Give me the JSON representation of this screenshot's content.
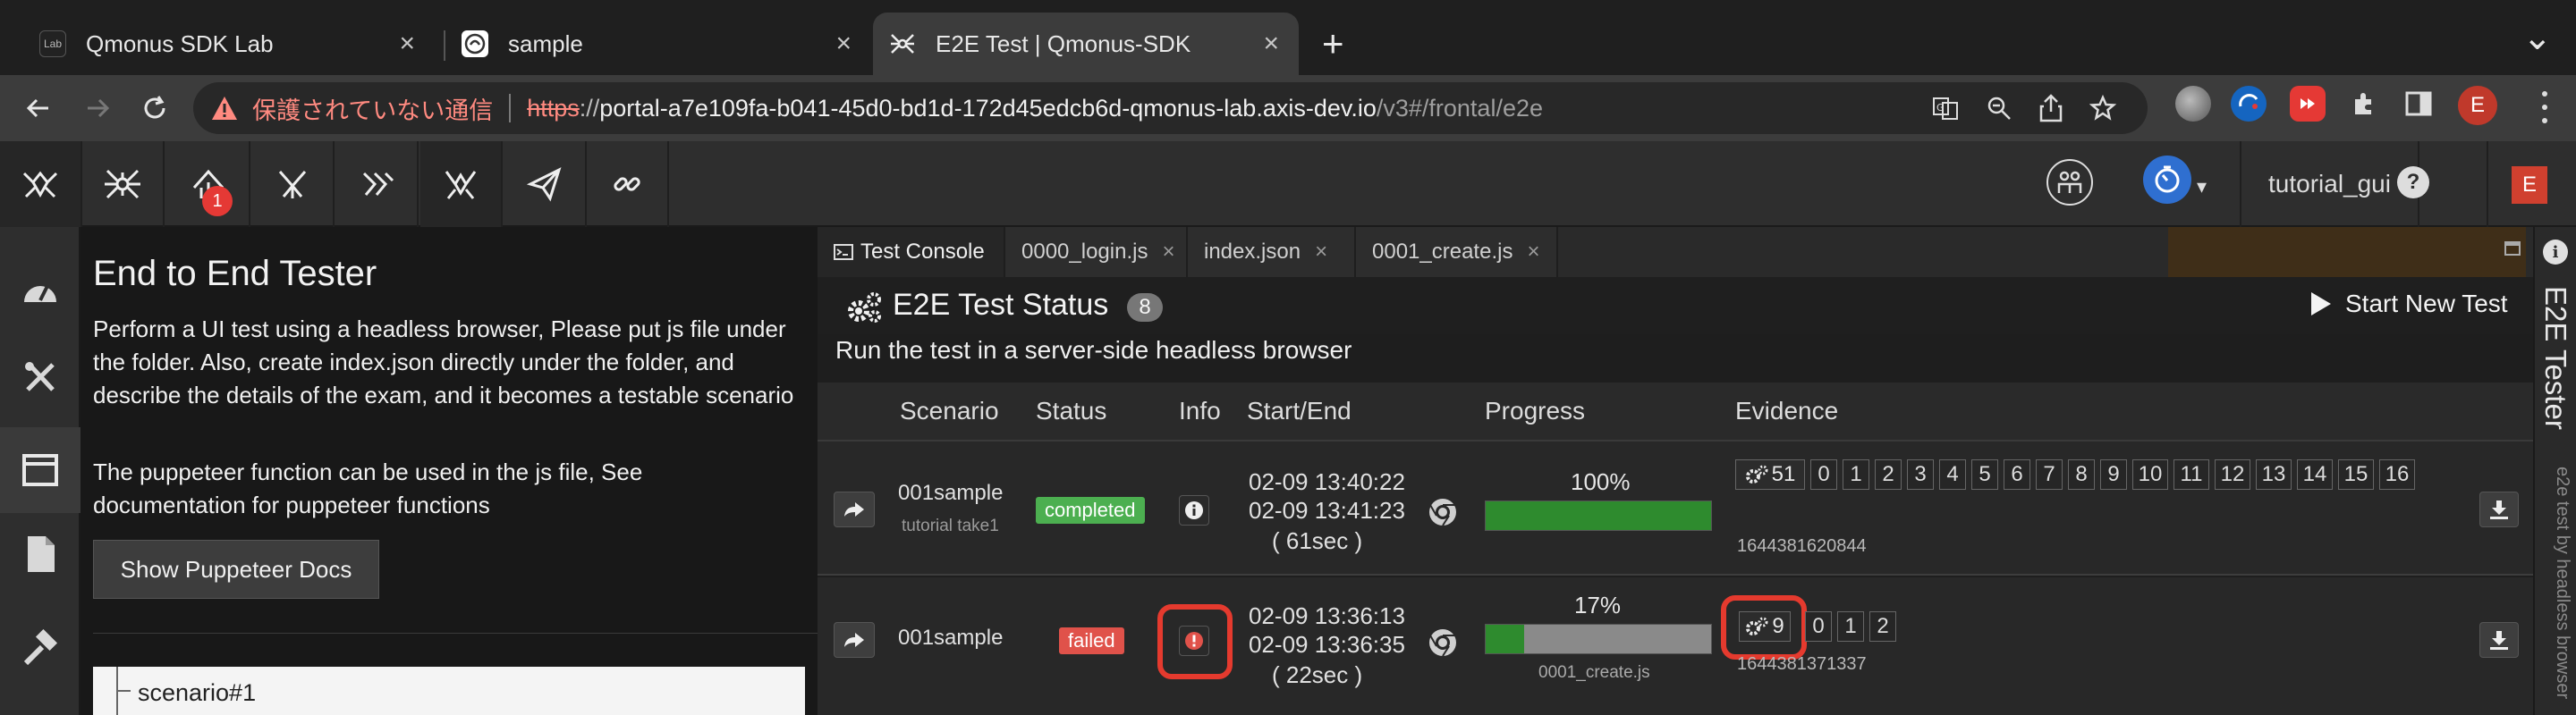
{
  "browser": {
    "tabs": [
      {
        "title": "Qmonus SDK Lab",
        "close": "×"
      },
      {
        "title": "sample",
        "close": "×"
      },
      {
        "title": "E2E Test | Qmonus-SDK",
        "close": "×"
      }
    ],
    "new_tab": "+",
    "tab_menu": "⌄",
    "address": {
      "security_text": "保護されていない通信",
      "url_scheme": "https",
      "url_slashes": "://",
      "url_host": "portal-a7e109fa-b041-45d0-bd1d-172d45edcb6d-qmonus-lab.axis-dev.io",
      "url_path": "/v3#/frontal/e2e"
    },
    "profile_initial": "E"
  },
  "app": {
    "notification_badge": "1",
    "user_name": "tutorial_gui",
    "user_initial": "E",
    "left_panel": {
      "title": "End to End Tester",
      "description": "Perform a UI test using a headless browser, Please put js file under the folder. Also, create index.json directly under the folder, and describe the details of the exam, and it becomes a testable scenario",
      "puppeteer_note": "The puppeteer function can be used in the js file, See documentation for puppeteer functions",
      "docs_button": "Show Puppeteer Docs",
      "tree_item": "scenario#1"
    },
    "workspace_tabs": [
      {
        "label": "Test Console",
        "close": ""
      },
      {
        "label": "0000_login.js",
        "close": "×"
      },
      {
        "label": "index.json",
        "close": "×"
      },
      {
        "label": "0001_create.js",
        "close": "×"
      }
    ],
    "status": {
      "title": "E2E Test Status",
      "count": "8",
      "start_button": "Start New Test",
      "subtitle": "Run the test in a server-side headless browser"
    },
    "table": {
      "headers": {
        "scenario": "Scenario",
        "status": "Status",
        "info": "Info",
        "start_end": "Start/End",
        "progress": "Progress",
        "evidence": "Evidence"
      },
      "rows": [
        {
          "scenario": "001sample",
          "sub": "tutorial take1",
          "status": "completed",
          "status_color": "#4caf50",
          "start": "02-09 13:40:22",
          "end": "02-09 13:41:23",
          "duration": "( 61sec )",
          "progress_text": "100%",
          "progress_fraction": 1.0,
          "progress_caption": "",
          "evidence_count": "51",
          "evidence_items": [
            "0",
            "1",
            "2",
            "3",
            "4",
            "5",
            "6",
            "7",
            "8",
            "9",
            "10",
            "11",
            "12",
            "13",
            "14",
            "15",
            "16"
          ],
          "evidence_id": "1644381620844"
        },
        {
          "scenario": "001sample",
          "sub": "",
          "status": "failed",
          "status_color": "#e0524a",
          "start": "02-09 13:36:13",
          "end": "02-09 13:36:35",
          "duration": "( 22sec )",
          "progress_text": "17%",
          "progress_fraction": 0.17,
          "progress_caption": "0001_create.js",
          "evidence_count": "9",
          "evidence_items": [
            "0",
            "1",
            "2"
          ],
          "evidence_id": "1644381371337"
        }
      ]
    },
    "side_tab": {
      "title": "E2E Tester",
      "subtitle": "e2e test by headless browser"
    }
  }
}
